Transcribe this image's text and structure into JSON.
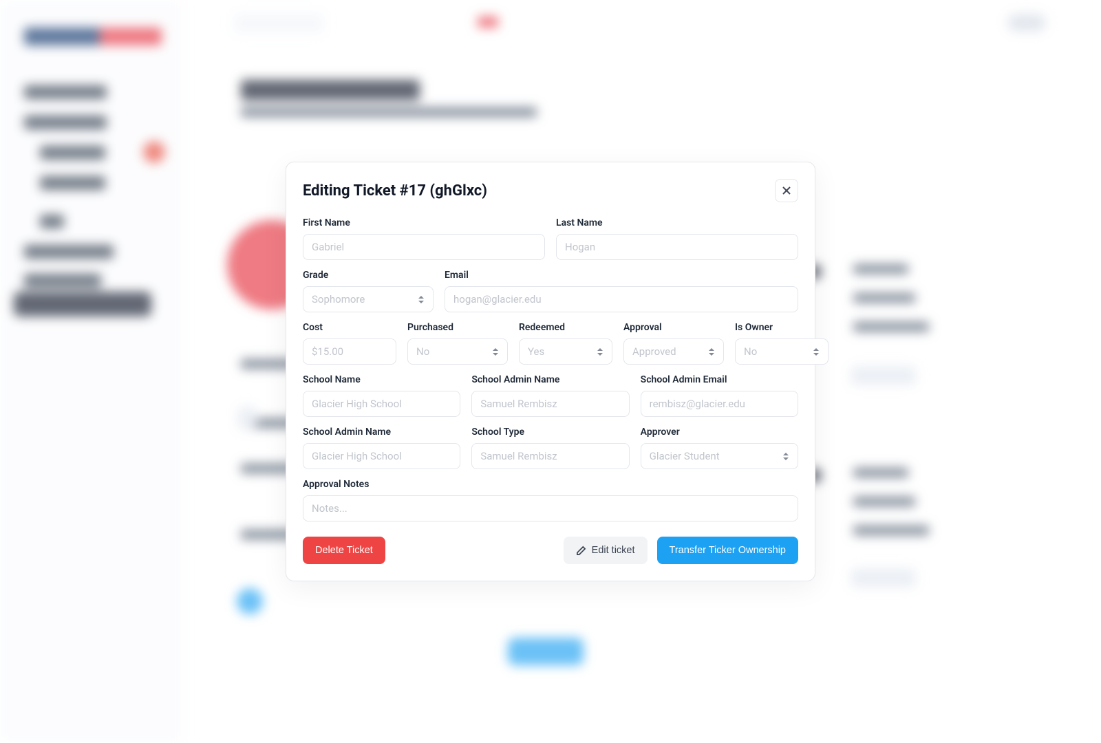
{
  "modal": {
    "title": "Editing Ticket #17 (ghGlxc)",
    "labels": {
      "firstName": "First Name",
      "lastName": "Last Name",
      "grade": "Grade",
      "email": "Email",
      "cost": "Cost",
      "purchased": "Purchased",
      "redeemed": "Redeemed",
      "approval": "Approval",
      "isOwner": "Is Owner",
      "schoolName": "School Name",
      "schoolAdminName": "School Admin Name",
      "schoolAdminEmail": "School Admin Email",
      "schoolAdminName2": "School Admin Name",
      "schoolType": "School Type",
      "approver": "Approver",
      "approvalNotes": "Approval Notes"
    },
    "values": {
      "firstName": "Gabriel",
      "lastName": "Hogan",
      "grade": "Sophomore",
      "email": "hogan@glacier.edu",
      "cost": "$15.00",
      "purchased": "No",
      "redeemed": "Yes",
      "approval": "Approved",
      "isOwner": "No",
      "schoolName": "Glacier High School",
      "schoolAdminName": "Samuel Rembisz",
      "schoolAdminEmail": "rembisz@glacier.edu",
      "schoolAdminName2": "Glacier High School",
      "schoolType": "Samuel Rembisz",
      "approver": "Glacier Student",
      "approvalNotesPlaceholder": "Notes..."
    },
    "buttons": {
      "delete": "Delete Ticket",
      "edit": "Edit ticket",
      "transfer": "Transfer Ticker Ownership"
    }
  }
}
